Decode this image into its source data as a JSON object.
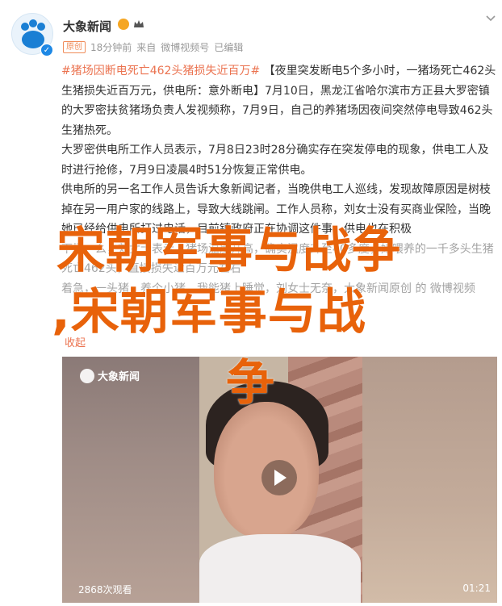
{
  "post": {
    "author": "大象新闻",
    "origin_tag": "原创",
    "time": "18分钟前",
    "source_prefix": "来自",
    "source": "微博视频号",
    "edit_label": "已编辑"
  },
  "body": {
    "p1": [
      {
        "text": "#猪场因断电死亡462头猪损失近百万#",
        "hl": true
      },
      {
        "text": " 【夜里突发断电5个多小时，一猪场死亡462头生猪损失近百万元，供电所：意外断电】7月10日，黑龙江省哈尔滨市方正县大罗密镇的大罗密扶贫猪场负责人发视频称，7月9日，自己的养猪场因夜间突然停电导致462头生猪热死。",
        "hl": false
      }
    ],
    "p2": "大罗密供电所工作人员表示，7月8日23时28分确实存在突发停电的现象，供电工人及时进行抢修，7月9日凌晨4时51分恢复正常供电。",
    "p3": "供电所的另一名工作人员告诉大象新闻记者，当晚供电工人巡线，发现故障原因是树枝掉在另一用户家的线路上，导致大线跳闸。工作人员称，刘女士没有买商业保险，当晚她已经给供电所打过电话，目前镇政府正在协调这件事，供电也在积极",
    "p4": "下场一么，刘女士表示，猪场温度升高，确实温度升至40多度，她喂养的一千多头生猪死亡462头，直接损失近百万元左右",
    "p5": "着急，一头猪，养个小猪，我能猪上睡觉，刘女士无奈，大象新闻原创 的 微博视频",
    "collapse": "收起"
  },
  "overlay": {
    "line1": "宋朝军事与战争",
    "line2": ",宋朝军事与战",
    "line3": "争"
  },
  "video": {
    "logo_text": "大象新闻",
    "views": "2868次观看",
    "duration": "01:21"
  },
  "colors": {
    "accent": "#eb7350",
    "overlay": "#e8620a",
    "verified": "#1e88e5"
  }
}
